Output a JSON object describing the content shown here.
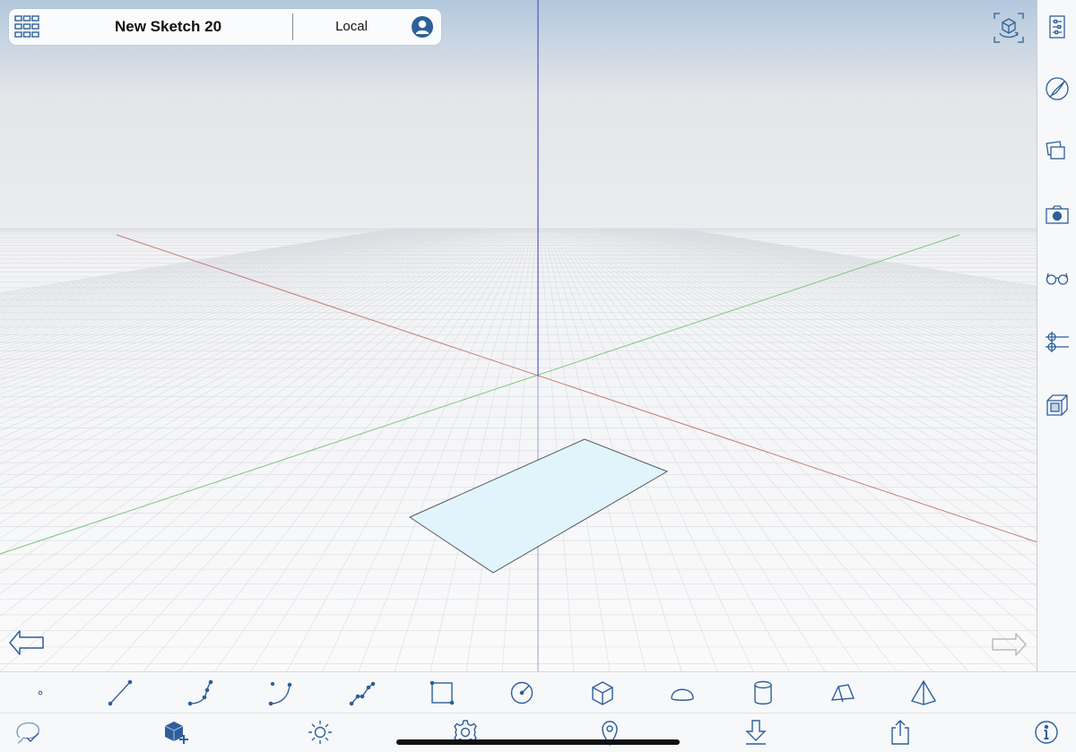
{
  "document": {
    "title": "New Sketch 20",
    "storage_mode": "Local"
  },
  "colors": {
    "accent": "#2e5f99",
    "x_axis": "#c77b7b",
    "y_axis": "#7cc47c",
    "z_axis": "#4b5bbd",
    "face_fill": "#e1f4fb",
    "disabled": "#b7bbc1"
  },
  "titlebar": {
    "menu_icon": "grid-menu-icon",
    "account_icon": "user-avatar-icon"
  },
  "viewport": {
    "view_cube_icon": "view-cube-icon",
    "undo_icon": "undo-arrow-icon",
    "redo_icon": "redo-arrow-icon",
    "redo_enabled": false
  },
  "sidebar": {
    "items": [
      "settings-sliders-icon",
      "paint-brush-icon",
      "layers-icon",
      "camera-icon",
      "glasses-icon",
      "snapping-icon",
      "section-box-icon"
    ]
  },
  "draw_tools": [
    "point-icon",
    "line-icon",
    "polyline-icon",
    "arc-icon",
    "spline-icon",
    "rectangle-icon",
    "circle-icon",
    "box-icon",
    "hemisphere-icon",
    "cylinder-icon",
    "wedge-icon",
    "pyramid-icon"
  ],
  "bottom_tools": [
    "select-lasso-icon",
    "add-object-icon",
    "lighting-icon",
    "settings-gear-icon",
    "location-pin-icon",
    "import-icon",
    "share-icon",
    "info-icon"
  ]
}
